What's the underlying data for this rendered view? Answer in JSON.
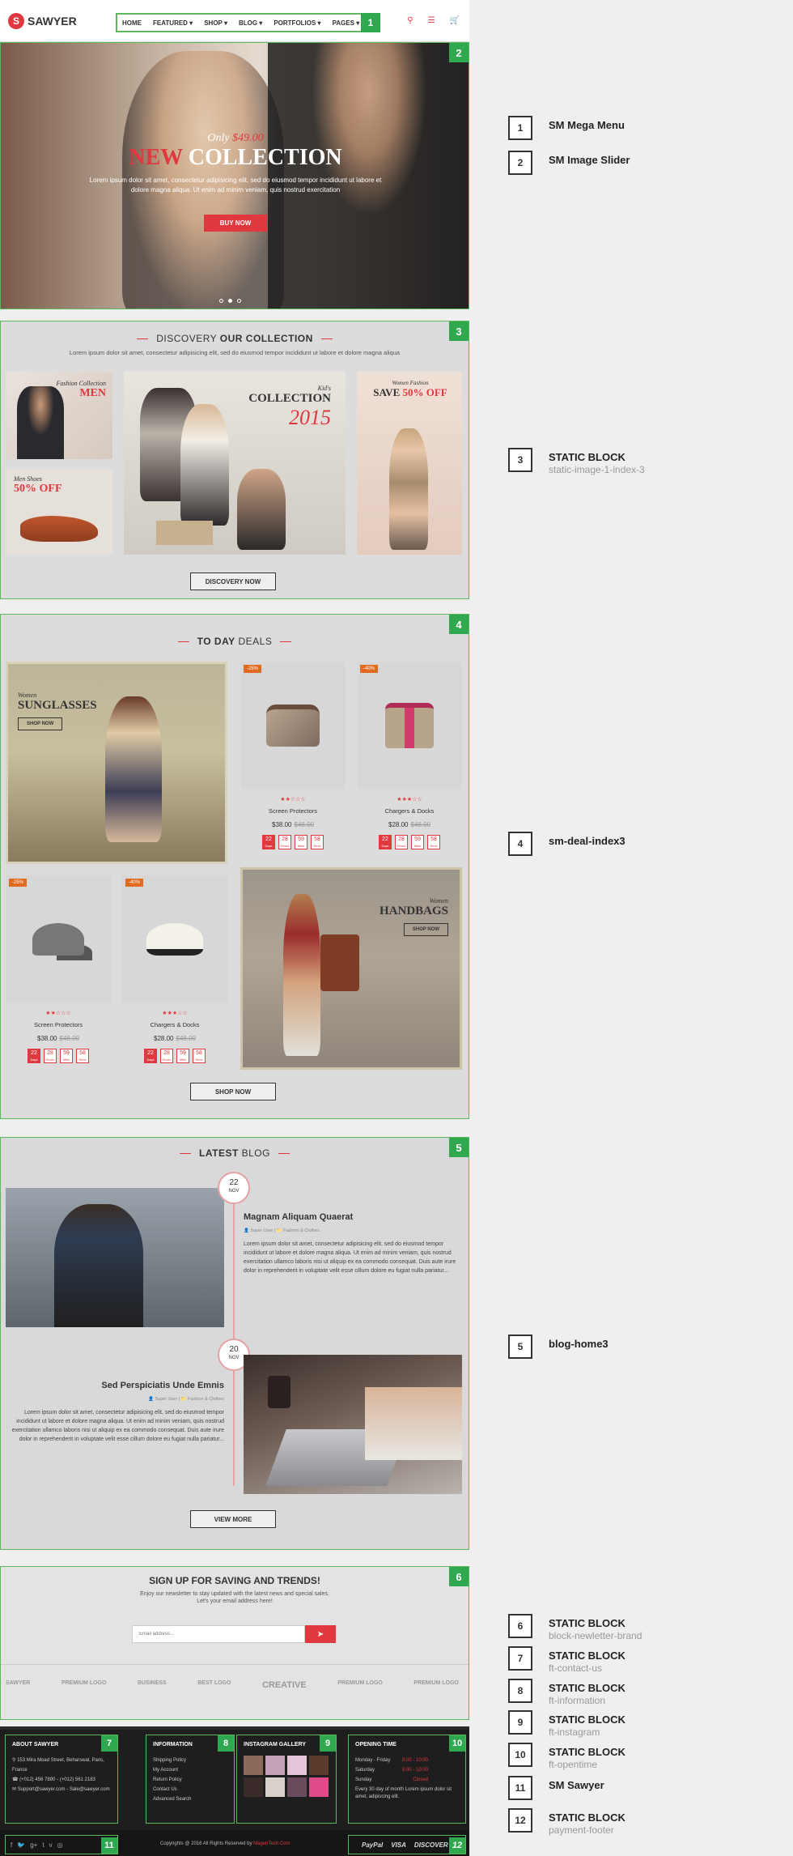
{
  "header": {
    "logo_icon": "S",
    "logo_text": "SAWYER",
    "menu": [
      "HOME",
      "FEATURED ▾",
      "SHOP ▾",
      "BLOG ▾",
      "PORTFOLIOS ▾",
      "PAGES ▾"
    ],
    "badge": "1"
  },
  "slider": {
    "badge": "2",
    "only": "Only",
    "price": "$49.00",
    "title_new": "NEW",
    "title_collection": " COLLECTION",
    "desc": "Lorem ipsum dolor sit amet, consectetur adipisicing elit, sed do eiusmod tempor incididunt ut labore et dolore magna aliqua. Ut enim ad minim veniam, quis nostrud exercitation",
    "button": "BUY NOW"
  },
  "collection": {
    "badge": "3",
    "heading_thin": "DISCOVERY ",
    "heading_bold": "OUR COLLECTION",
    "sub": "Lorem ipsum dolor sit amet, consectetur adipisicing elit, sed do eiusmod tempor incididunt ut labore et dolore magna aliqua",
    "men_small": "Fashion Collection",
    "men_big": "MEN",
    "shoes_small": "Men Shoes",
    "shoes_big": "50% OFF",
    "kids_small": "Kid's",
    "kids_big": "COLLECTION",
    "kids_year": "2015",
    "women_small": "Women Fashion",
    "women_big_a": "SAVE ",
    "women_big_b": "50% OFF",
    "button": "DISCOVERY NOW"
  },
  "deals": {
    "badge": "4",
    "heading_bold": "TO DAY",
    "heading_thin": " DEALS",
    "sunglasses_small": "Women",
    "sunglasses_big": "SUNGLASSES",
    "sunglasses_btn": "SHOP NOW",
    "handbags_small": "Women",
    "handbags_big": "HANDBAGS",
    "handbags_btn": "SHOP NOW",
    "button": "SHOP NOW",
    "products": [
      {
        "tag": "-25%",
        "name": "Screen Protectors",
        "price": "$38.00",
        "old": "$48.00",
        "stars": "★★☆☆☆"
      },
      {
        "tag": "-40%",
        "name": "Chargers & Docks",
        "price": "$28.00",
        "old": "$48.00",
        "stars": "★★★☆☆"
      },
      {
        "tag": "-25%",
        "name": "Screen Protectors",
        "price": "$38.00",
        "old": "$48.00",
        "stars": "★★☆☆☆"
      },
      {
        "tag": "-40%",
        "name": "Chargers & Docks",
        "price": "$28.00",
        "old": "$48.00",
        "stars": "★★★☆☆"
      }
    ],
    "countdown": [
      {
        "v": "22",
        "u": "Days"
      },
      {
        "v": "28",
        "u": "Hours"
      },
      {
        "v": "59",
        "u": "Mins"
      },
      {
        "v": "58",
        "u": "Secs"
      }
    ]
  },
  "blog": {
    "badge": "5",
    "heading_bold": "LATEST",
    "heading_thin": " BLOG",
    "button": "VIEW MORE",
    "post1": {
      "day": "22",
      "month": "NOV",
      "title": "Magnam Aliquam Quaerat",
      "author": "Super User",
      "cat": "Fashion & Clothes",
      "text": "Lorem ipsum dolor sit amet, consectetur adipisicing elit, sed do eiusmod tempor incididunt ut labore et dolore magna aliqua. Ut enim ad minim veniam, quis nostrud exercitation ullamco laboris nisi ut aliquip ex ea commodo consequat. Duis aute irure dolor in reprehenderit in voluptate velit esse cillum dolore eu fugiat nulla pariatur..."
    },
    "post2": {
      "day": "20",
      "month": "NOV",
      "title": "Sed Perspiciatis Unde Emnis",
      "author": "Super User",
      "cat": "Fashion & Clothes",
      "text": "Lorem ipsum dolor sit amet, consectetur adipisicing elit, sed do eiusmod tempor incididunt ut labore et dolore magna aliqua. Ut enim ad minim veniam, quis nostrud exercitation ullamco laboris nisi ut aliquip ex ea commodo consequat. Duis aute irure dolor in reprehenderit in voluptate velit esse cillum dolore eu fugiat nulla pariatur..."
    }
  },
  "newsletter": {
    "badge": "6",
    "title": "SIGN UP FOR SAVING AND TRENDS!",
    "desc1": "Enjoy our newsletter to stay updated with the latest news and special sales.",
    "desc2": "Let's your email address here!",
    "placeholder": "Email address...",
    "brands": [
      "SAWYER",
      "PREMIUM LOGO",
      "BUSINESS",
      "BEST LOGO",
      "CREATIVE",
      "PREMIUM LOGO",
      "PREMIUM LOGO"
    ]
  },
  "footer": {
    "about": {
      "badge": "7",
      "title": "ABOUT SAWYER",
      "address": "153 Mira Moad Street, Beharswal, Paris, France",
      "phone": "(+012) 456 7890 - (+012) 561 2183",
      "email": "Support@sawyer.com - Sale@sawyer.com"
    },
    "info": {
      "badge": "8",
      "title": "INFORMATION",
      "links": [
        "Shipping Policy",
        "My Account",
        "Return Policy",
        "Contact Us",
        "Advanced Search"
      ]
    },
    "insta": {
      "badge": "9",
      "title": "INSTAGRAM GALLERY"
    },
    "open": {
      "badge": "10",
      "title": "OPENING TIME",
      "rows": [
        {
          "d": "Monday - Friday",
          "t": "8:00 - 10:00"
        },
        {
          "d": "Saturday",
          "t": "8:00 - 10:00"
        },
        {
          "d": "Sunday",
          "t": "Closed"
        }
      ],
      "note": "Every 30 day of month Lorem ipsum dolor sit amet, adipiscing elit."
    },
    "social_badge": "11",
    "social": [
      "f",
      "🐦",
      "g+",
      "t",
      "v",
      "◎"
    ],
    "copyright_a": "Copyrights @ 2016 All Rights Reserved by ",
    "copyright_b": "MagenTech.Com",
    "pay_badge": "12",
    "payments": [
      "PayPal",
      "VISA",
      "DISCOVER"
    ]
  },
  "legend": [
    {
      "num": "1",
      "title": "SM Mega Menu",
      "sub": ""
    },
    {
      "num": "2",
      "title": "SM Image Slider",
      "sub": ""
    },
    {
      "num": "3",
      "title": "STATIC BLOCK",
      "sub": "static-image-1-index-3"
    },
    {
      "num": "4",
      "title": "sm-deal-index3",
      "sub": ""
    },
    {
      "num": "5",
      "title": "blog-home3",
      "sub": ""
    },
    {
      "num": "6",
      "title": "STATIC BLOCK",
      "sub": "block-newletter-brand"
    },
    {
      "num": "7",
      "title": "STATIC BLOCK",
      "sub": "ft-contact-us"
    },
    {
      "num": "8",
      "title": "STATIC BLOCK",
      "sub": "ft-information"
    },
    {
      "num": "9",
      "title": "STATIC BLOCK",
      "sub": "ft-instagram"
    },
    {
      "num": "10",
      "title": "STATIC BLOCK",
      "sub": "ft-opentime"
    },
    {
      "num": "11",
      "title": "SM Sawyer",
      "sub": ""
    },
    {
      "num": "12",
      "title": "STATIC BLOCK",
      "sub": "payment-footer"
    }
  ]
}
